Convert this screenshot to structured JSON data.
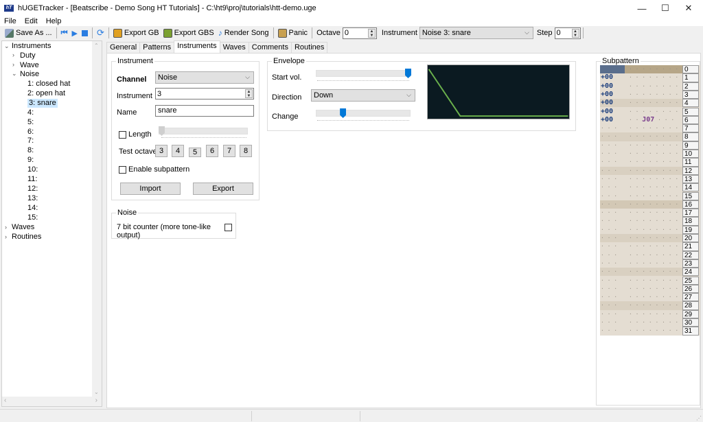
{
  "window": {
    "title": "hUGETracker - [Beatscribe - Demo Song HT Tutorials] - C:\\ht9\\proj\\tutorials\\htt-demo.uge",
    "icon_text": "hT",
    "minimize": "—",
    "maximize": "☐",
    "close": "✕"
  },
  "menu": [
    "File",
    "Edit",
    "Help"
  ],
  "toolbar": {
    "save_as": "Save As ...",
    "export_gb": "Export GB",
    "export_gbs": "Export GBS",
    "render_song": "Render Song",
    "panic": "Panic",
    "octave_label": "Octave",
    "octave_value": "0",
    "instrument_label": "Instrument",
    "instrument_value": "Noise 3: snare",
    "step_label": "Step",
    "step_value": "0"
  },
  "tree": {
    "root": "Instruments",
    "duty": "Duty",
    "wave": "Wave",
    "noise": "Noise",
    "noise_items": [
      "1: closed hat",
      "2: open hat",
      "3: snare",
      "4:",
      "5:",
      "6:",
      "7:",
      "8:",
      "9:",
      "10:",
      "11:",
      "12:",
      "13:",
      "14:",
      "15:"
    ],
    "selected_index": 2,
    "waves": "Waves",
    "routines": "Routines"
  },
  "tabs": [
    "General",
    "Patterns",
    "Instruments",
    "Waves",
    "Comments",
    "Routines"
  ],
  "active_tab": "Instruments",
  "instrument_group": {
    "title": "Instrument",
    "channel_label": "Channel",
    "channel_value": "Noise",
    "instrument_label": "Instrument",
    "instrument_value": "3",
    "name_label": "Name",
    "name_value": "snare",
    "length_label": "Length",
    "length_checked": false,
    "length_value": 0,
    "test_octave_label": "Test octave:",
    "octaves": [
      "3",
      "4",
      "5",
      "6",
      "7",
      "8"
    ],
    "enable_subpattern_label": "Enable subpattern",
    "enable_subpattern_checked": false,
    "import_label": "Import",
    "export_label": "Export"
  },
  "noise_group": {
    "title": "Noise",
    "seven_bit_label": "7 bit counter (more tone-like output)",
    "seven_bit_checked": false
  },
  "envelope_group": {
    "title": "Envelope",
    "start_vol_label": "Start vol.",
    "start_vol_value": 15,
    "start_vol_max": 15,
    "direction_label": "Direction",
    "direction_value": "Down",
    "change_label": "Change",
    "change_value": 2,
    "change_max": 7,
    "graph_color": "#6ab04c"
  },
  "subpattern": {
    "title": "Subpattern",
    "rows": [
      {
        "n": "0",
        "note": "",
        "fx": ""
      },
      {
        "n": "1",
        "note": "+00",
        "fx": ""
      },
      {
        "n": "2",
        "note": "+00",
        "fx": ""
      },
      {
        "n": "3",
        "note": "+00",
        "fx": ""
      },
      {
        "n": "4",
        "note": "+00",
        "fx": ""
      },
      {
        "n": "5",
        "note": "+00",
        "fx": ""
      },
      {
        "n": "6",
        "note": "+00",
        "fx": "J07"
      },
      {
        "n": "7"
      },
      {
        "n": "8"
      },
      {
        "n": "9"
      },
      {
        "n": "10"
      },
      {
        "n": "11"
      },
      {
        "n": "12"
      },
      {
        "n": "13"
      },
      {
        "n": "14"
      },
      {
        "n": "15"
      },
      {
        "n": "16"
      },
      {
        "n": "17"
      },
      {
        "n": "18"
      },
      {
        "n": "19"
      },
      {
        "n": "20"
      },
      {
        "n": "21"
      },
      {
        "n": "22"
      },
      {
        "n": "23"
      },
      {
        "n": "24"
      },
      {
        "n": "25"
      },
      {
        "n": "26"
      },
      {
        "n": "27"
      },
      {
        "n": "28"
      },
      {
        "n": "29"
      },
      {
        "n": "30"
      },
      {
        "n": "31"
      }
    ]
  }
}
